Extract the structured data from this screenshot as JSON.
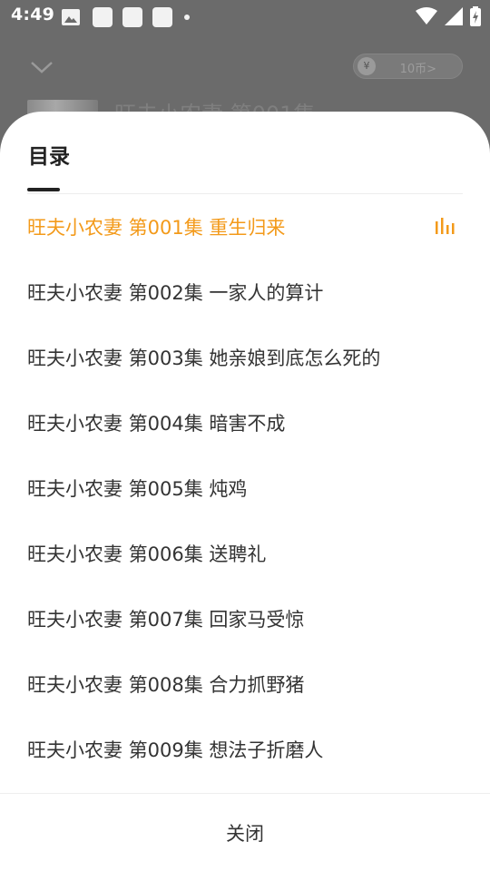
{
  "status_bar": {
    "time": "4:49",
    "left_icons": [
      "image-icon",
      "notification-square-icon",
      "notification-square-icon",
      "notification-square-icon",
      "dot-icon"
    ],
    "right_icons": [
      "wifi-icon",
      "signal-icon",
      "battery-icon"
    ]
  },
  "background_player": {
    "coin_button": "10币>",
    "title": "旺夫小农妻 第001集"
  },
  "catalog_sheet": {
    "title": "目录",
    "accent_color": "#f39a1a",
    "episodes": [
      {
        "label": "旺夫小农妻 第001集 重生归来",
        "active": true
      },
      {
        "label": "旺夫小农妻 第002集 一家人的算计",
        "active": false
      },
      {
        "label": "旺夫小农妻 第003集 她亲娘到底怎么死的",
        "active": false
      },
      {
        "label": "旺夫小农妻 第004集 暗害不成",
        "active": false
      },
      {
        "label": "旺夫小农妻 第005集 炖鸡",
        "active": false
      },
      {
        "label": "旺夫小农妻 第006集 送聘礼",
        "active": false
      },
      {
        "label": "旺夫小农妻 第007集 回家马受惊",
        "active": false
      },
      {
        "label": "旺夫小农妻 第008集 合力抓野猪",
        "active": false
      },
      {
        "label": "旺夫小农妻 第009集 想法子折磨人",
        "active": false
      }
    ],
    "close_label": "关闭"
  }
}
